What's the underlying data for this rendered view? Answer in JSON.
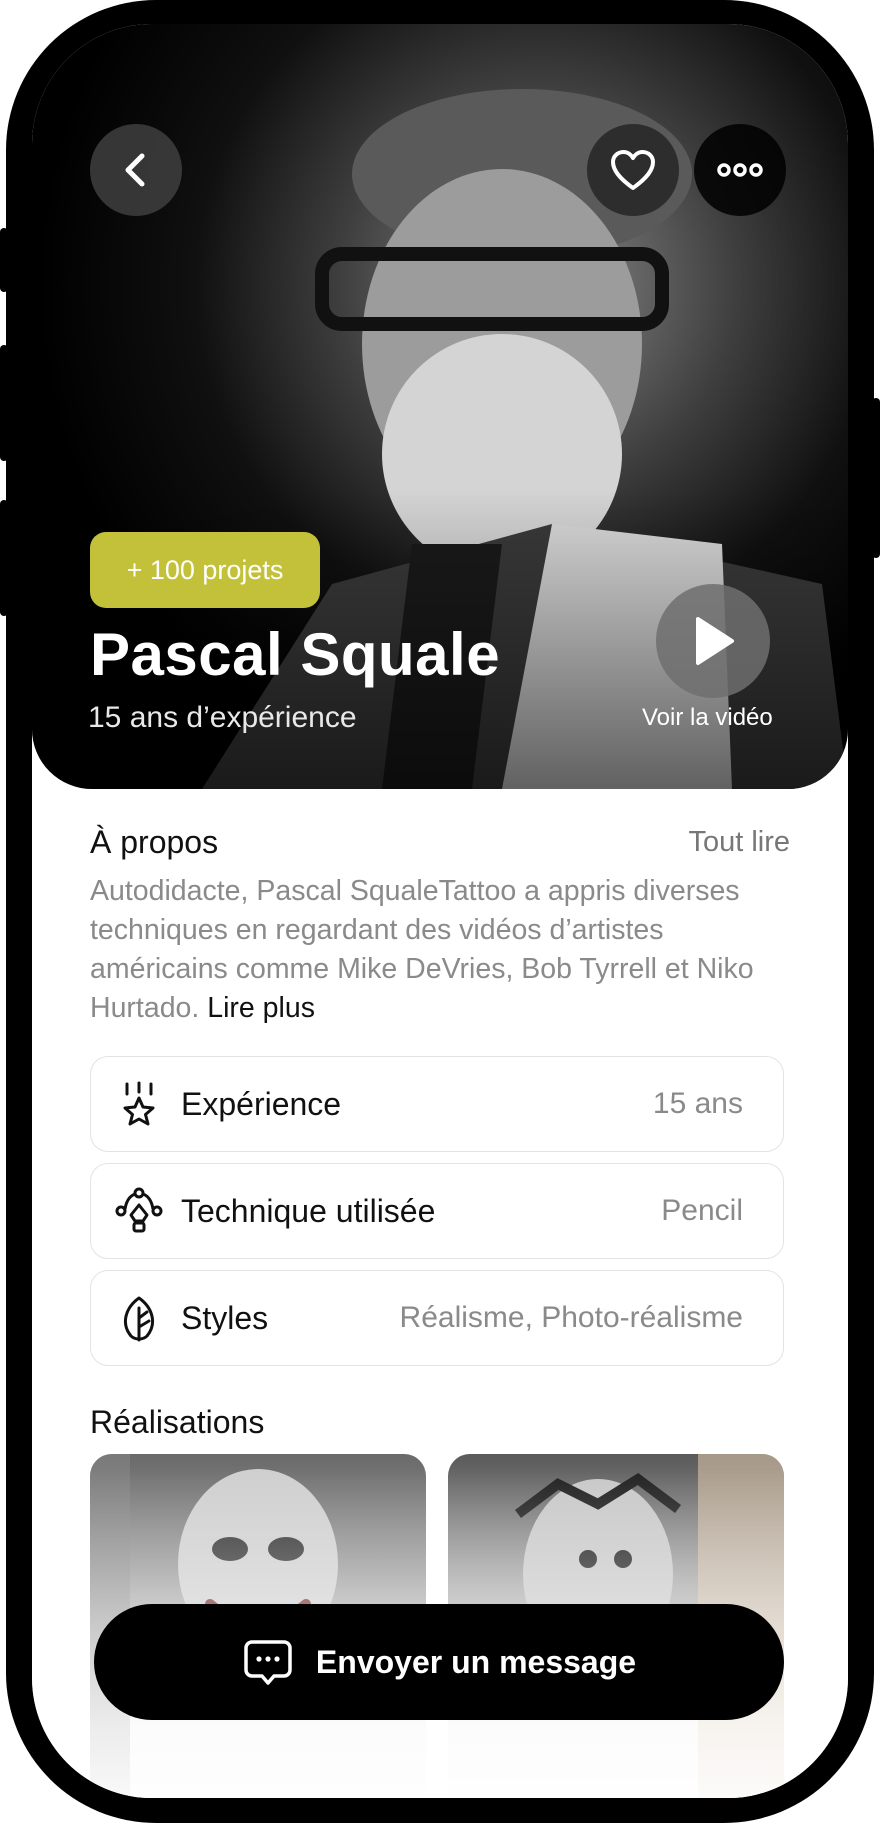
{
  "profile": {
    "badge": "+ 100 projets",
    "name": "Pascal Squale",
    "experience_subtitle": "15 ans d’expérience",
    "video_label": "Voir la vidéo"
  },
  "about": {
    "title": "À propos",
    "read_all": "Tout lire",
    "text": "Autodidacte, Pascal SqualeTattoo a appris diverses techniques en regardant des vidéos d’artistes américains comme Mike DeVries, Bob Tyrrell et Niko Hurtado. ",
    "read_more": "Lire plus"
  },
  "details": [
    {
      "label": "Expérience",
      "value": "15 ans",
      "icon": "star-sparkle-icon"
    },
    {
      "label": "Technique utilisée",
      "value": "Pencil",
      "icon": "technique-nodes-icon"
    },
    {
      "label": "Styles",
      "value": "Réalisme, Photo-réalisme",
      "icon": "leaf-icon"
    }
  ],
  "works": {
    "title": "Réalisations"
  },
  "cta": {
    "label": "Envoyer un message",
    "icon": "chat-bubble-icon"
  }
}
